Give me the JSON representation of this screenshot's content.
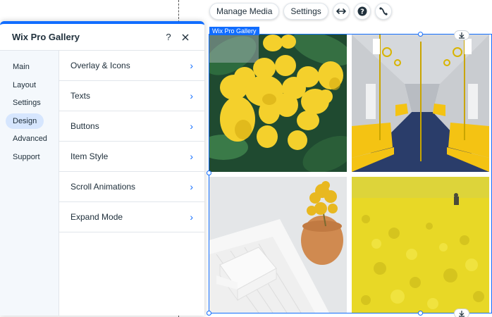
{
  "toolbar": {
    "manage_media": "Manage Media",
    "settings": "Settings",
    "icons": [
      "stretch-icon",
      "help-icon",
      "animation-icon"
    ]
  },
  "panel": {
    "title": "Wix Pro Gallery",
    "help_glyph": "?",
    "nav": [
      {
        "label": "Main"
      },
      {
        "label": "Layout"
      },
      {
        "label": "Settings"
      },
      {
        "label": "Design",
        "active": true
      },
      {
        "label": "Advanced"
      },
      {
        "label": "Support"
      }
    ],
    "rows": [
      {
        "label": "Overlay & Icons"
      },
      {
        "label": "Texts"
      },
      {
        "label": "Buttons"
      },
      {
        "label": "Item Style"
      },
      {
        "label": "Scroll Animations"
      },
      {
        "label": "Expand Mode"
      }
    ]
  },
  "gallery": {
    "selection_label": "Wix Pro Gallery",
    "images": [
      "lemons",
      "subway-train",
      "soap-and-flowers",
      "rapeseed-field"
    ]
  },
  "colors": {
    "accent": "#116dff",
    "nav_active_bg": "#d6e6fe",
    "text": "#20303c"
  }
}
